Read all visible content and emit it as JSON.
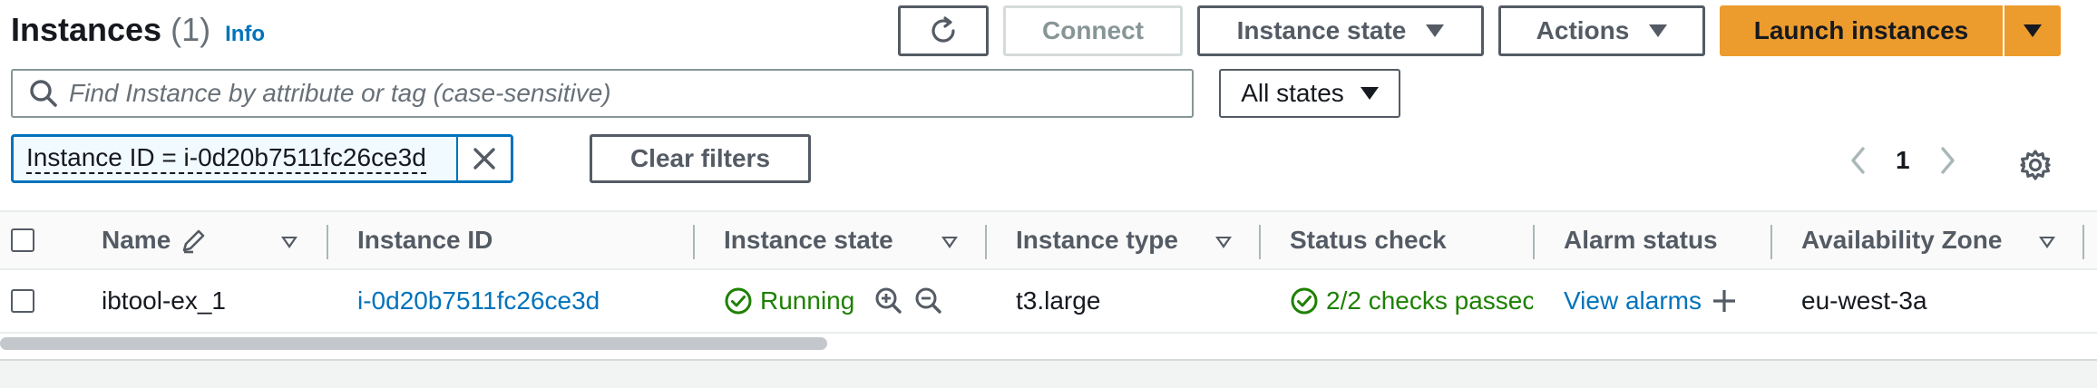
{
  "header": {
    "title": "Instances",
    "count": "(1)",
    "info_link": "Info"
  },
  "toolbar": {
    "connect_label": "Connect",
    "instance_state_label": "Instance state",
    "actions_label": "Actions",
    "launch_label": "Launch instances"
  },
  "search": {
    "placeholder": "Find Instance by attribute or tag (case-sensitive)"
  },
  "state_filter": {
    "selected": "All states"
  },
  "filters": {
    "token": "Instance ID = i-0d20b7511fc26ce3d",
    "clear_label": "Clear filters"
  },
  "pagination": {
    "current_page": "1"
  },
  "table": {
    "columns": [
      "Name",
      "Instance ID",
      "Instance state",
      "Instance type",
      "Status check",
      "Alarm status",
      "Availability Zone"
    ],
    "rows": [
      {
        "name": "ibtool-ex_1",
        "instance_id": "i-0d20b7511fc26ce3d",
        "state": "Running",
        "type": "t3.large",
        "status_check": "2/2 checks passec",
        "alarm": "View alarms",
        "az": "eu-west-3a"
      }
    ]
  },
  "colors": {
    "primary_orange": "#ec9b2d",
    "link_blue": "#0073bb",
    "success_green": "#1d8102"
  }
}
